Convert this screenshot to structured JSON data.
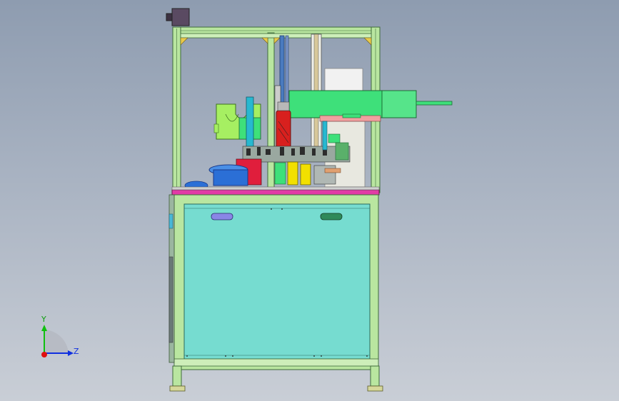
{
  "view": {
    "background_top": "#8e9cb0",
    "background_bottom": "#c9ced6"
  },
  "colors": {
    "frame": "#b9e6a0",
    "frame_edge": "#3f6b3a",
    "cabinet_panel": "#76dcd0",
    "bed_stripe": "#e23aa6",
    "green_part": "#3ee07a",
    "red_cylinder": "#d8201e",
    "yellow_block": "#f2e000",
    "blue_bowl": "#2b6fd6",
    "purple_handle": "#8a86e6",
    "dark_handle": "#2f8a5a",
    "motor_box": "#5a4a62",
    "white_box": "#f1f1f1"
  },
  "triad": {
    "y_label": "Y",
    "z_label": "Z",
    "y_color": "#10c010",
    "z_color": "#1030e0",
    "x_color": "#e01010"
  }
}
